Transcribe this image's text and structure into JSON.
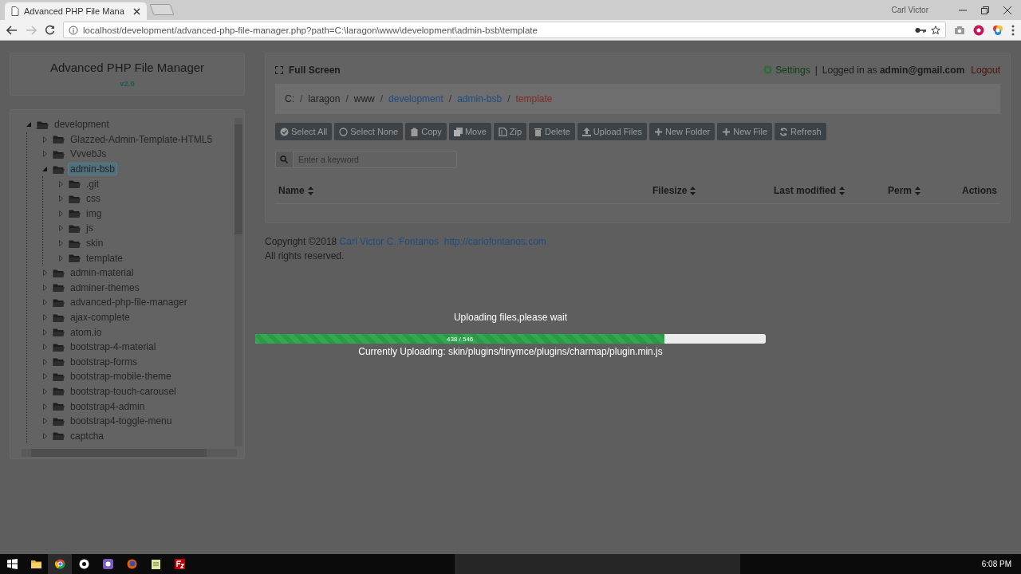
{
  "browser": {
    "tab_title": "Advanced PHP File Mana",
    "profile": "Carl Victor",
    "url": "localhost/development/advanced-php-file-manager.php?path=C:\\laragon\\www\\development\\admin-bsb\\template"
  },
  "sidebar": {
    "title": "Advanced PHP File Manager",
    "version": "v2.0",
    "tree": [
      {
        "label": "development",
        "expanded": true,
        "selected": false,
        "children": [
          {
            "label": "Glazzed-Admin-Template-HTML5",
            "expanded": false,
            "selected": false
          },
          {
            "label": "VvvebJs",
            "expanded": false,
            "selected": false
          },
          {
            "label": "admin-bsb",
            "expanded": true,
            "selected": true,
            "children": [
              {
                "label": ".git",
                "expanded": false,
                "selected": false
              },
              {
                "label": "css",
                "expanded": false,
                "selected": false
              },
              {
                "label": "img",
                "expanded": false,
                "selected": false
              },
              {
                "label": "js",
                "expanded": false,
                "selected": false
              },
              {
                "label": "skin",
                "expanded": false,
                "selected": false
              },
              {
                "label": "template",
                "expanded": false,
                "selected": false
              }
            ]
          },
          {
            "label": "admin-material",
            "expanded": false,
            "selected": false
          },
          {
            "label": "adminer-themes",
            "expanded": false,
            "selected": false
          },
          {
            "label": "advanced-php-file-manager",
            "expanded": false,
            "selected": false
          },
          {
            "label": "ajax-complete",
            "expanded": false,
            "selected": false
          },
          {
            "label": "atom.io",
            "expanded": false,
            "selected": false
          },
          {
            "label": "bootstrap-4-material",
            "expanded": false,
            "selected": false
          },
          {
            "label": "bootstrap-forms",
            "expanded": false,
            "selected": false
          },
          {
            "label": "bootstrap-mobile-theme",
            "expanded": false,
            "selected": false
          },
          {
            "label": "bootstrap-touch-carousel",
            "expanded": false,
            "selected": false
          },
          {
            "label": "bootstrap4-admin",
            "expanded": false,
            "selected": false
          },
          {
            "label": "bootstrap4-toggle-menu",
            "expanded": false,
            "selected": false
          },
          {
            "label": "captcha",
            "expanded": false,
            "selected": false
          }
        ]
      }
    ]
  },
  "header": {
    "fullscreen": "Full Screen",
    "settings": "Settings",
    "separator": "|",
    "login": "Logged in as **admin@gmail.com**",
    "logout": "Logout"
  },
  "breadcrumb": [
    {
      "label": "C:",
      "kind": "plain"
    },
    {
      "label": "/",
      "kind": "separator"
    },
    {
      "label": "laragon",
      "kind": "plain"
    },
    {
      "label": "/",
      "kind": "separator"
    },
    {
      "label": "www",
      "kind": "plain"
    },
    {
      "label": "/",
      "kind": "separator"
    },
    {
      "label": "development",
      "kind": "link"
    },
    {
      "label": "/",
      "kind": "separator"
    },
    {
      "label": "admin-bsb",
      "kind": "link"
    },
    {
      "label": "/",
      "kind": "separator"
    },
    {
      "label": "template",
      "kind": "current"
    }
  ],
  "toolbar": [
    "Select All",
    "Select None",
    "Copy",
    "Move",
    "Zip",
    "Delete",
    "Upload Files",
    "New Folder",
    "New File",
    "Refresh"
  ],
  "search": {
    "placeholder": "Enter a keyword"
  },
  "table": {
    "columns": [
      {
        "label": "Name",
        "sortable": true
      },
      {
        "label": "Filesize",
        "sortable": true
      },
      {
        "label": "Last modified",
        "sortable": true
      },
      {
        "label": "Perm",
        "sortable": true
      },
      {
        "label": "Actions",
        "sortable": false
      }
    ]
  },
  "footer": {
    "copyright": "Copyright ©2018",
    "author": "Carl Victor C. Fontanos",
    "website": "http://carlofontanos.com",
    "rights": "All rights reserved."
  },
  "upload": {
    "message": "Uploading files,please wait",
    "level": 0.802,
    "count": "438 / 546",
    "current": "Currently Uploading: skin/plugins/tinymce/plugins/charmap/plugin.min.js"
  },
  "taskbar": {
    "time": "6:08 PM"
  }
}
